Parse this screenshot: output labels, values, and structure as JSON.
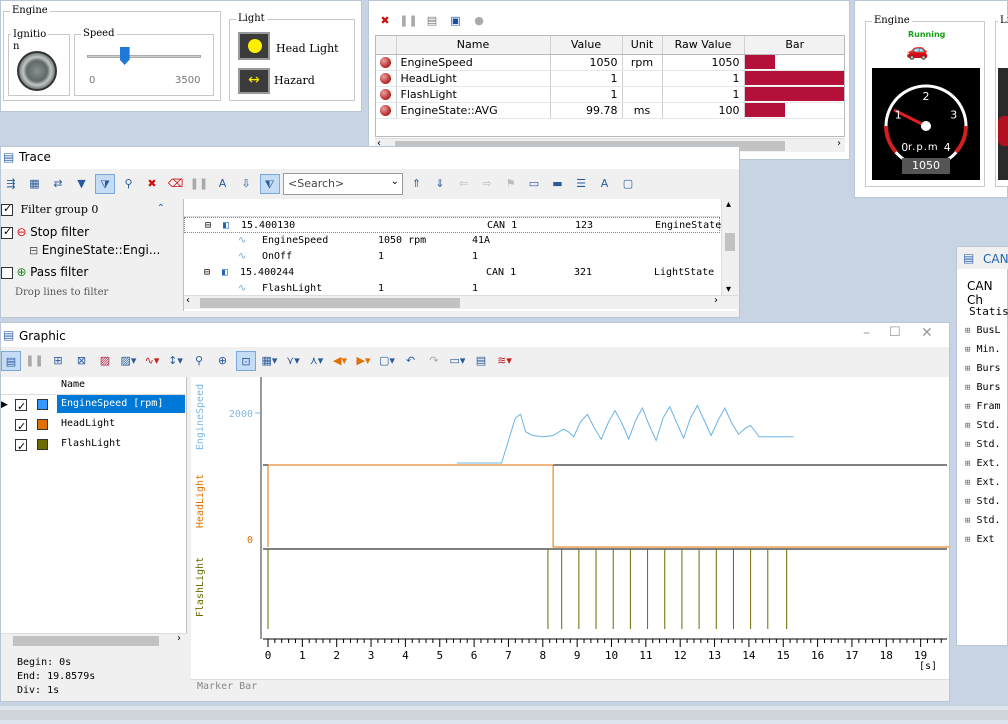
{
  "panel_controls": {
    "engine_title": "Engine",
    "ignition_label": "Ignitio\nn",
    "speed_label": "Speed",
    "speed_min": "0",
    "speed_max": "3500",
    "speed_value_fraction": 0.33,
    "light_title": "Light",
    "headlight_label": "Head Light",
    "hazard_label": "Hazard"
  },
  "signal_table": {
    "columns": [
      "Name",
      "Value",
      "Unit",
      "Raw Value",
      "Bar"
    ],
    "rows": [
      {
        "name": "EngineSpeed",
        "value": "1050",
        "unit": "rpm",
        "raw": "1050",
        "bar_fraction": 0.3
      },
      {
        "name": "HeadLight",
        "value": "1",
        "unit": "",
        "raw": "1",
        "bar_fraction": 1.0
      },
      {
        "name": "FlashLight",
        "value": "1",
        "unit": "",
        "raw": "1",
        "bar_fraction": 1.0
      },
      {
        "name": "EngineState::AVG",
        "value": "99.78",
        "unit": "ms",
        "raw": "100",
        "bar_fraction": 0.4
      }
    ],
    "bar_color": "#b5103a"
  },
  "engine_panel": {
    "title": "Engine",
    "status": "Running",
    "gauge_unit": "r.p.m",
    "gauge_ticks": [
      "0",
      "1",
      "2",
      "3",
      "4"
    ],
    "gauge_value": "1050",
    "second_title": "Li"
  },
  "trace": {
    "title": "Trace",
    "search_placeholder": "<Search>",
    "filter_group": "Filter group 0",
    "stop_filter": "Stop filter",
    "stop_filter_item": "EngineState::Engi...",
    "pass_filter": "Pass filter",
    "drop_hint": "Drop lines to filter",
    "rows": [
      {
        "time": "15.400130",
        "channel": "CAN 1",
        "id": "123",
        "name": "EngineState",
        "kind": "msg"
      },
      {
        "sig": "EngineSpeed",
        "value": "1050 rpm",
        "raw": "41A",
        "kind": "sig"
      },
      {
        "sig": "OnOff",
        "value": "1",
        "raw": "1",
        "kind": "sig"
      },
      {
        "time": "15.400244",
        "channel": "CAN 1",
        "id": "321",
        "name": "LightState",
        "kind": "msg"
      },
      {
        "sig": "FlashLight",
        "value": "1",
        "raw": "1",
        "kind": "sig"
      }
    ]
  },
  "graphic": {
    "title": "Graphic",
    "signal_list_header": "Name",
    "signals": [
      {
        "name": "EngineSpeed [rpm]",
        "color": "#3399ff",
        "selected": true
      },
      {
        "name": "HeadLight",
        "color": "#e07000",
        "selected": false
      },
      {
        "name": "FlashLight",
        "color": "#6b6b00",
        "selected": false
      }
    ],
    "begin": "Begin: 0s",
    "end": "End:  19.8579s",
    "div": "Div: 1s",
    "marker_bar": "Marker Bar",
    "axis_unit": "[s]",
    "x_ticks": [
      "0",
      "1",
      "2",
      "3",
      "4",
      "5",
      "6",
      "7",
      "8",
      "9",
      "10",
      "11",
      "12",
      "13",
      "14",
      "15",
      "16",
      "17",
      "18",
      "19"
    ],
    "y_label_engine": "EngineSpeed",
    "y_label_head": "HeadLight",
    "y_label_flash": "FlashLight",
    "y_tick_2000": "2000",
    "y_tick_0": "0"
  },
  "chart_data": {
    "type": "line",
    "xlabel": "[s]",
    "xlim": [
      0,
      19.86
    ],
    "series": [
      {
        "name": "EngineSpeed",
        "color": "#6cb4e4",
        "x": [
          5.5,
          6.8,
          7.0,
          7.2,
          7.35,
          7.5,
          7.7,
          8.0,
          8.3,
          8.6,
          8.75,
          8.9,
          9.1,
          9.3,
          9.5,
          9.7,
          9.9,
          10.1,
          10.3,
          10.5,
          10.7,
          10.9,
          11.1,
          11.3,
          11.5,
          11.7,
          11.9,
          12.1,
          12.3,
          12.5,
          12.7,
          12.9,
          13.1,
          13.3,
          13.5,
          13.7,
          13.9,
          14.05,
          14.3,
          15.3
        ],
        "y": [
          0,
          0,
          900,
          1800,
          1950,
          1250,
          1100,
          1050,
          1100,
          1350,
          1250,
          1050,
          1650,
          1950,
          1400,
          950,
          1600,
          2100,
          1600,
          950,
          1700,
          2200,
          1500,
          900,
          1800,
          2250,
          1600,
          1000,
          1800,
          2300,
          1700,
          1100,
          1700,
          2200,
          1600,
          1150,
          1400,
          1500,
          1050,
          1050
        ]
      },
      {
        "name": "HeadLight",
        "color": "#e07000",
        "x": [
          0,
          8.3,
          8.3,
          19.86
        ],
        "y": [
          1,
          1,
          0,
          0
        ]
      },
      {
        "name": "FlashLight",
        "color": "#6b6b00",
        "pulses": [
          8.15,
          8.55,
          9.05,
          9.55,
          10.05,
          10.55,
          11.05,
          11.55,
          12.05,
          12.55,
          13.05,
          13.55,
          14.05,
          14.55,
          15.1
        ]
      }
    ]
  },
  "can_panel": {
    "title": "CAN",
    "subtitle": "CAN Ch",
    "header": "Statist",
    "items": [
      "BusL",
      "Min.",
      "Burs",
      "Burs",
      "Fram",
      "Std.",
      "Std.",
      "Ext.",
      "Ext.",
      "Std.",
      "Std.",
      "Ext"
    ]
  }
}
